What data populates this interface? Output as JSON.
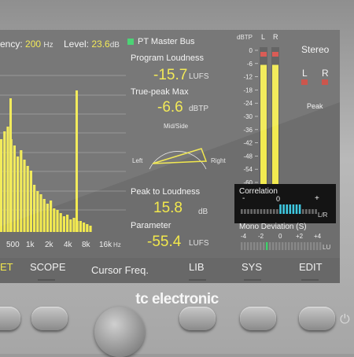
{
  "header": {
    "freq_label": "ency:",
    "freq_value": "200",
    "freq_unit": "Hz",
    "level_label": "Level:",
    "level_value": "23.6",
    "level_unit": "dB"
  },
  "spectrum": {
    "x_ticks": [
      "500",
      "1k",
      "2k",
      "4k",
      "8k",
      "16k"
    ],
    "x_unit": "Hz",
    "bar_color": "#f2ea50"
  },
  "loudness": {
    "bus_label": "PT Master Bus",
    "program_label": "Program Loudness",
    "program_value": "-15.7",
    "program_unit": "LUFS",
    "truepeak_label": "True-peak Max",
    "truepeak_value": "-6.6",
    "truepeak_unit": "dBTP",
    "midside_label": "Mid/Side",
    "left_label": "Left",
    "right_label": "Right",
    "ptl_label": "Peak to Loudness",
    "ptl_value": "15.8",
    "ptl_unit": "dB",
    "param_label": "Parameter",
    "param_value": "-55.4",
    "param_unit": "LUFS"
  },
  "meter": {
    "unit_label": "dBTP",
    "l_label": "L",
    "r_label": "R",
    "scale": [
      "0",
      "-6",
      "-12",
      "-18",
      "-24",
      "-30",
      "-36",
      "-42",
      "-48",
      "-54",
      "-60"
    ],
    "l_peak_db": -6.6,
    "r_peak_db": -6.6,
    "stereo_label": "Stereo",
    "stereo_l": "L",
    "stereo_r": "R",
    "peak_label": "Peak",
    "indicator_color": "#d0463c"
  },
  "correlation": {
    "title": "Correlation",
    "minus": "-",
    "zero": "0",
    "plus": "+",
    "lr_label": "L/R"
  },
  "mono": {
    "title": "Mono Deviation (S)",
    "ticks": [
      "-4",
      "-2",
      "0",
      "+2",
      "+4"
    ],
    "unit": "LU"
  },
  "tabs": [
    "ET",
    "SCOPE",
    "Cursor Freq.",
    "LIB",
    "SYS",
    "EDIT"
  ],
  "brand": "tc electronic"
}
